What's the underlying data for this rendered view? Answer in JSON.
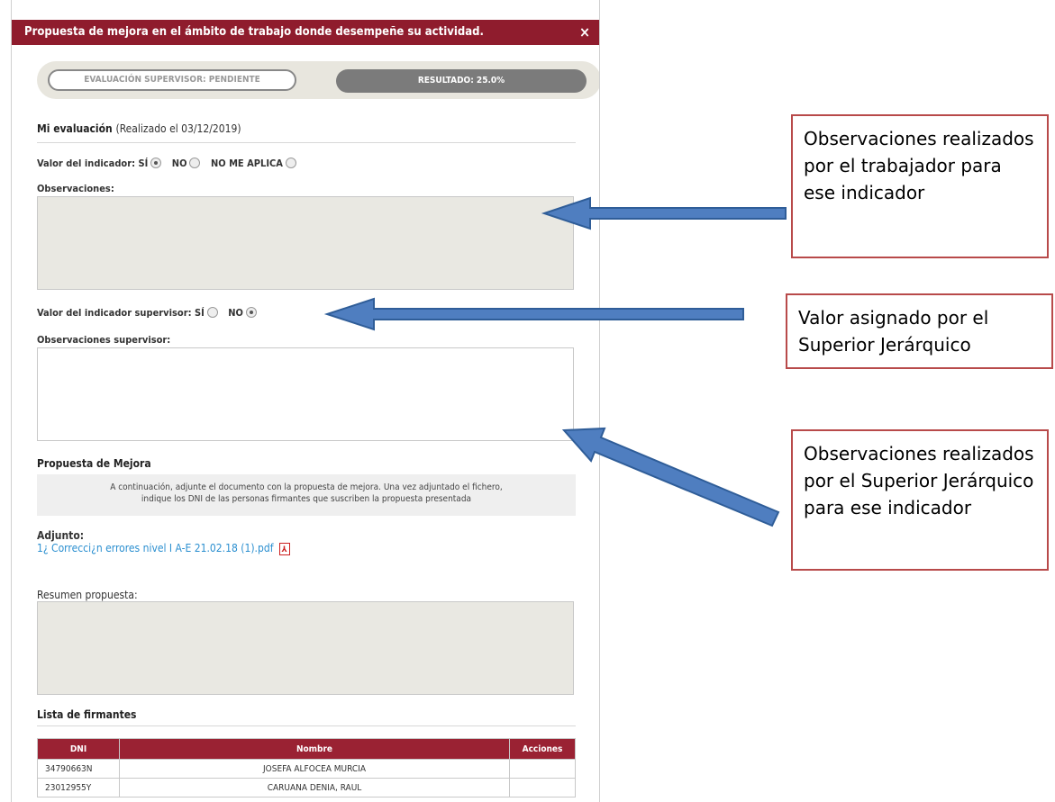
{
  "modal": {
    "title": "Propuesta de mejora en el ámbito de trabajo donde desempeñe su actividad.",
    "close_icon": "×"
  },
  "status": {
    "supervisor_eval": "EVALUACIÓN SUPERVISOR: PENDIENTE",
    "result": "RESULTADO: 25.0%"
  },
  "evaluation": {
    "title": "Mi evaluación",
    "date_note": "(Realizado el 03/12/2019)",
    "indicator_label": "Valor del indicador:",
    "options": [
      "SÍ",
      "NO",
      "NO ME APLICA"
    ],
    "selected": "SÍ",
    "observations_label": "Observaciones:"
  },
  "supervisor": {
    "indicator_label": "Valor del indicador supervisor:",
    "options": [
      "SÍ",
      "NO"
    ],
    "selected": "NO",
    "observations_label": "Observaciones supervisor:"
  },
  "proposal": {
    "title": "Propuesta de Mejora",
    "notice_line1": "A continuación, adjunte el documento con la propuesta de mejora. Una vez adjuntado el fichero,",
    "notice_line2": "indique los DNI de las personas firmantes que suscriben la propuesta presentada",
    "attachment_label": "Adjunto:",
    "attachment_file": "1¿ Correcci¿n errores nivel I A-E 21.02.18 (1).pdf",
    "summary_label": "Resumen propuesta:"
  },
  "signers": {
    "title": "Lista de firmantes",
    "columns": [
      "DNI",
      "Nombre",
      "Acciones"
    ],
    "rows": [
      {
        "dni": "34790663N",
        "name": "JOSEFA ALFOCEA MURCIA",
        "actions": ""
      },
      {
        "dni": "23012955Y",
        "name": "CARUANA DENIA, RAUL",
        "actions": ""
      }
    ]
  },
  "callouts": [
    {
      "text": "Observaciones realizados por el trabajador para ese indicador"
    },
    {
      "text": "Valor asignado por el Superior Jerárquico"
    },
    {
      "text": "Observaciones realizados por el Superior Jerárquico para ese indicador"
    }
  ],
  "colors": {
    "header_bg": "#8f1c2d",
    "table_header_bg": "#9a2233",
    "arrow_fill": "#4f7ec0",
    "callout_border": "#b84a4a",
    "link": "#2b8fd0"
  }
}
